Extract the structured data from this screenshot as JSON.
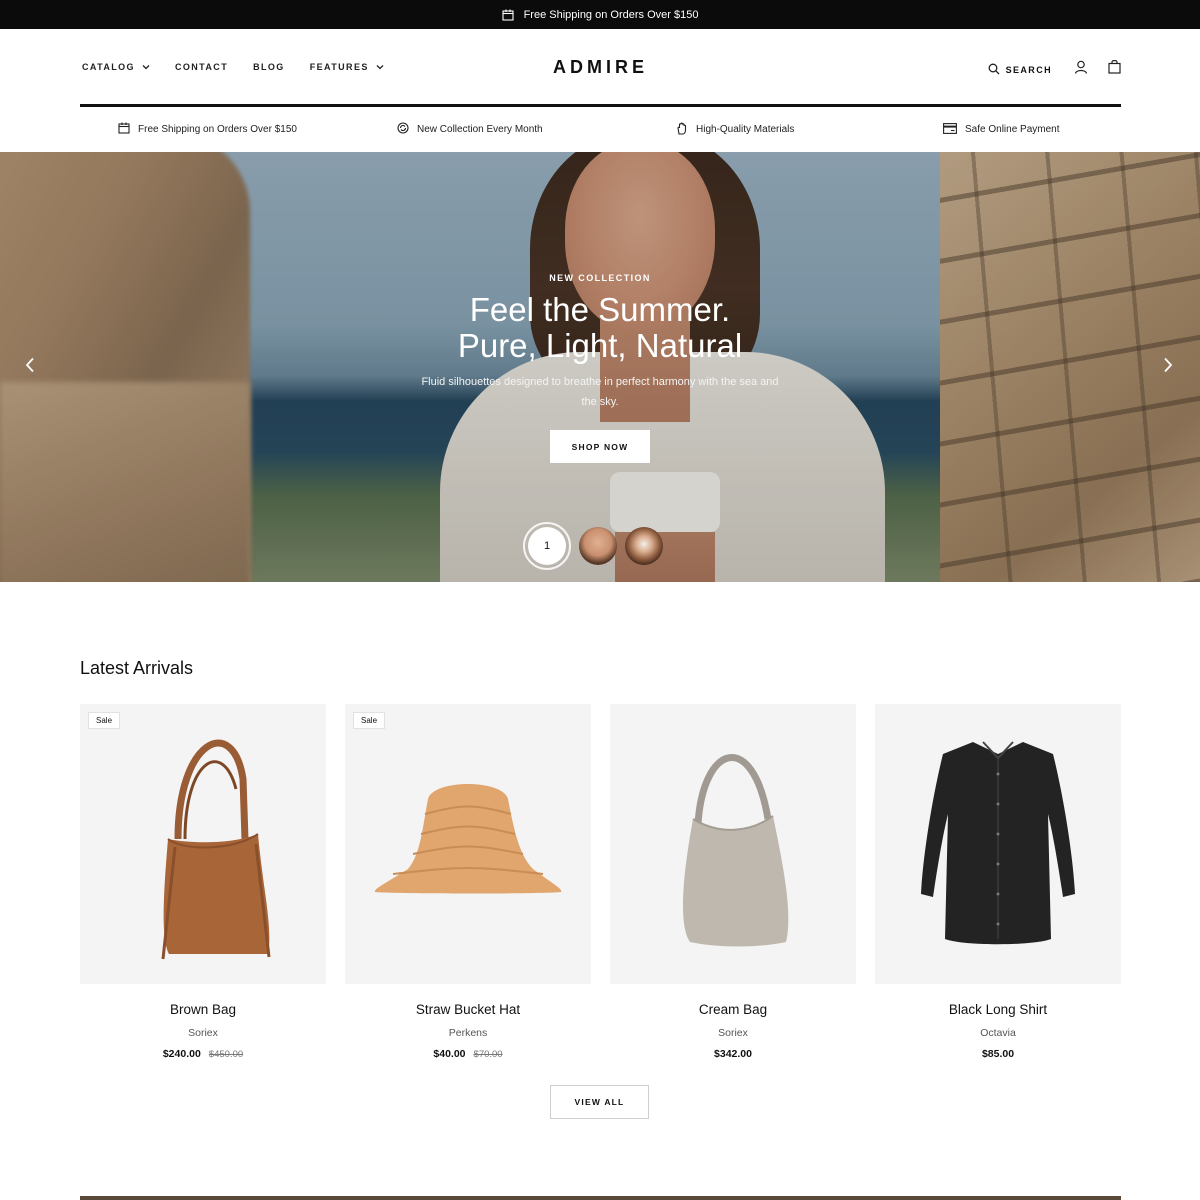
{
  "announcement": {
    "icon": "calendar-icon",
    "text": "Free Shipping on Orders Over $150"
  },
  "nav": {
    "items": [
      {
        "label": "CATALOG",
        "has_dropdown": true
      },
      {
        "label": "CONTACT",
        "has_dropdown": false
      },
      {
        "label": "BLOG",
        "has_dropdown": false
      },
      {
        "label": "FEATURES",
        "has_dropdown": true
      }
    ]
  },
  "logo": "ADMIRE",
  "header_actions": {
    "search_label": "SEARCH"
  },
  "features": [
    {
      "icon": "calendar-icon",
      "text": "Free Shipping on Orders Over $150"
    },
    {
      "icon": "refresh-icon",
      "text": "New Collection Every Month"
    },
    {
      "icon": "hand-icon",
      "text": "High-Quality Materials"
    },
    {
      "icon": "credit-card-icon",
      "text": "Safe Online Payment"
    }
  ],
  "hero": {
    "eyebrow": "NEW COLLECTION",
    "title_line1": "Feel the Summer.",
    "title_line2": "Pure, Light, Natural",
    "subtitle": "Fluid silhouettes designed to breathe in perfect harmony with the sea and the sky.",
    "cta": "SHOP NOW",
    "active_slide": "1"
  },
  "latest": {
    "title": "Latest Arrivals",
    "products": [
      {
        "name": "Brown Bag",
        "brand": "Soriex",
        "price": "$240.00",
        "compare_price": "$450.00",
        "badge": "Sale"
      },
      {
        "name": "Straw Bucket Hat",
        "brand": "Perkens",
        "price": "$40.00",
        "compare_price": "$70.00",
        "badge": "Sale"
      },
      {
        "name": "Cream Bag",
        "brand": "Soriex",
        "price": "$342.00",
        "compare_price": "",
        "badge": ""
      },
      {
        "name": "Black Long Shirt",
        "brand": "Octavia",
        "price": "$85.00",
        "compare_price": "",
        "badge": ""
      }
    ],
    "view_all": "VIEW ALL"
  }
}
